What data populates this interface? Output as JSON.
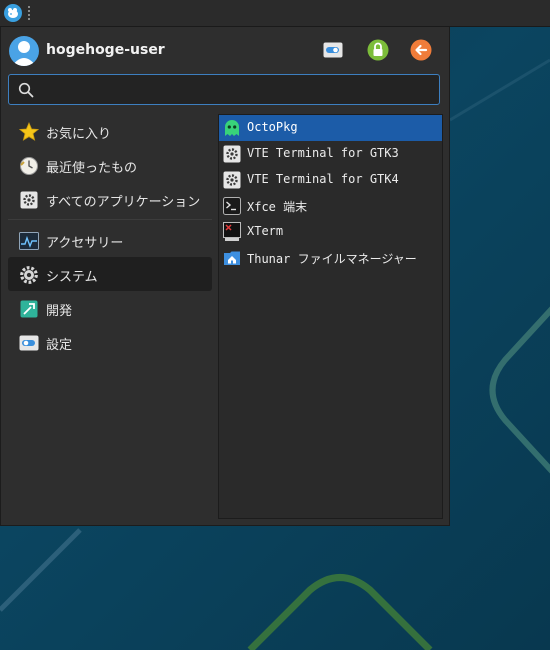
{
  "user": {
    "name": "hogehoge-user"
  },
  "search": {
    "placeholder": "",
    "value": ""
  },
  "categories": [
    {
      "label": "お気に入り",
      "icon": "star-icon"
    },
    {
      "label": "最近使ったもの",
      "icon": "clock-icon"
    },
    {
      "label": "すべてのアプリケーション",
      "icon": "gear-icon"
    },
    {
      "label": "アクセサリー",
      "icon": "chart-icon"
    },
    {
      "label": "システム",
      "icon": "cog-icon",
      "active": true
    },
    {
      "label": "開発",
      "icon": "hammer-icon"
    },
    {
      "label": "設定",
      "icon": "toggle-icon"
    }
  ],
  "apps": [
    {
      "label": "OctoPkg",
      "icon": "ghost-icon",
      "selected": true
    },
    {
      "label": "VTE Terminal for GTK3",
      "icon": "settings-icon"
    },
    {
      "label": "VTE Terminal for GTK4",
      "icon": "settings-icon"
    },
    {
      "label": "Xfce 端末",
      "icon": "terminal-icon"
    },
    {
      "label": "XTerm",
      "icon": "xterm-icon"
    },
    {
      "label": "Thunar ファイルマネージャー",
      "icon": "folder-home-icon"
    }
  ],
  "colors": {
    "accent": "#1c5ca8",
    "search_border": "#3d7fc0",
    "lock": "#7cbd3a",
    "logout": "#f07c3a"
  }
}
